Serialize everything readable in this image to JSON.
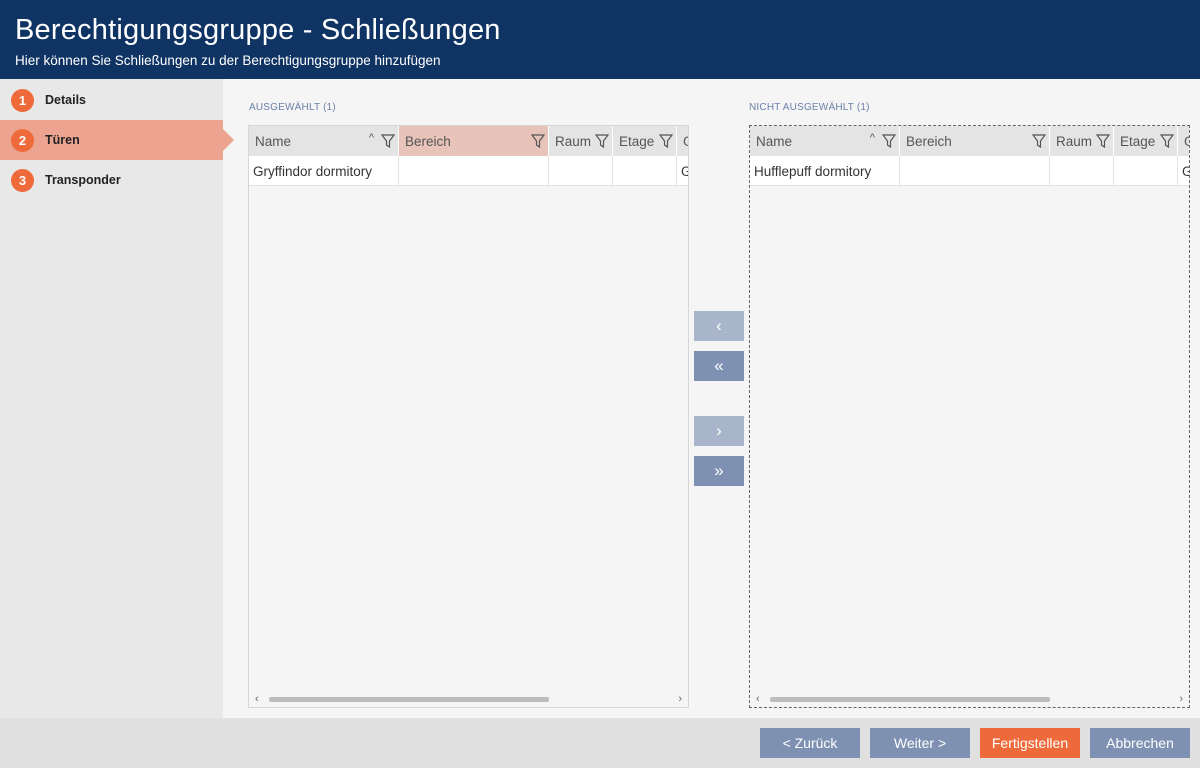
{
  "header": {
    "title": "Berechtigungsgruppe - Schließungen",
    "subtitle": "Hier können Sie Schließungen zu der Berechtigungsgruppe hinzufügen"
  },
  "steps": [
    {
      "num": "1",
      "label": "Details"
    },
    {
      "num": "2",
      "label": "Türen"
    },
    {
      "num": "3",
      "label": "Transponder"
    }
  ],
  "selected": {
    "label": "AUSGEWÄHLT (1)",
    "columns": [
      "Name",
      "Bereich",
      "Raum",
      "Etage",
      "G"
    ],
    "rows": [
      [
        "Gryffindor dormitory",
        "",
        "",
        "",
        "G"
      ]
    ]
  },
  "unselected": {
    "label": "NICHT AUSGEWÄHLT (1)",
    "columns": [
      "Name",
      "Bereich",
      "Raum",
      "Etage",
      "G"
    ],
    "rows": [
      [
        "Hufflepuff dormitory",
        "",
        "",
        "",
        "G"
      ]
    ]
  },
  "move_buttons": {
    "add_one": "‹",
    "add_all": "«",
    "remove_one": "›",
    "remove_all": "»"
  },
  "footer": {
    "back": "< Zurück",
    "next": "Weiter >",
    "finish": "Fertigstellen",
    "cancel": "Abbrechen"
  },
  "colors": {
    "header_bg": "#0f3464",
    "accent": "#ee6a3b",
    "active_step": "#eca38f",
    "button": "#7e91b3"
  }
}
